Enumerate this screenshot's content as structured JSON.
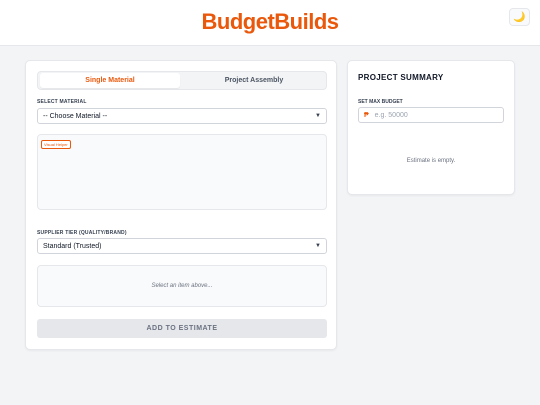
{
  "header": {
    "logo": "BudgetBuilds",
    "theme_icon": "moon-icon",
    "theme_glyph": "🌙"
  },
  "tabs": {
    "single": "Single Material",
    "assembly": "Project Assembly"
  },
  "material": {
    "label": "SELECT MATERIAL",
    "value": "-- Choose Material --"
  },
  "helper": {
    "badge": "Visual Helper"
  },
  "supplier": {
    "label": "SUPPLIER TIER (QUALITY/BRAND)",
    "value": "Standard (Trusted)"
  },
  "preview": {
    "text": "Select an item above..."
  },
  "actions": {
    "add_label": "ADD TO ESTIMATE"
  },
  "summary": {
    "title": "PROJECT SUMMARY",
    "budget_label": "SET MAX BUDGET",
    "currency": "₱",
    "budget_placeholder": "e.g. 50000",
    "empty": "Estimate is empty."
  },
  "colors": {
    "accent": "#ea580c",
    "background": "#f3f4f6"
  }
}
